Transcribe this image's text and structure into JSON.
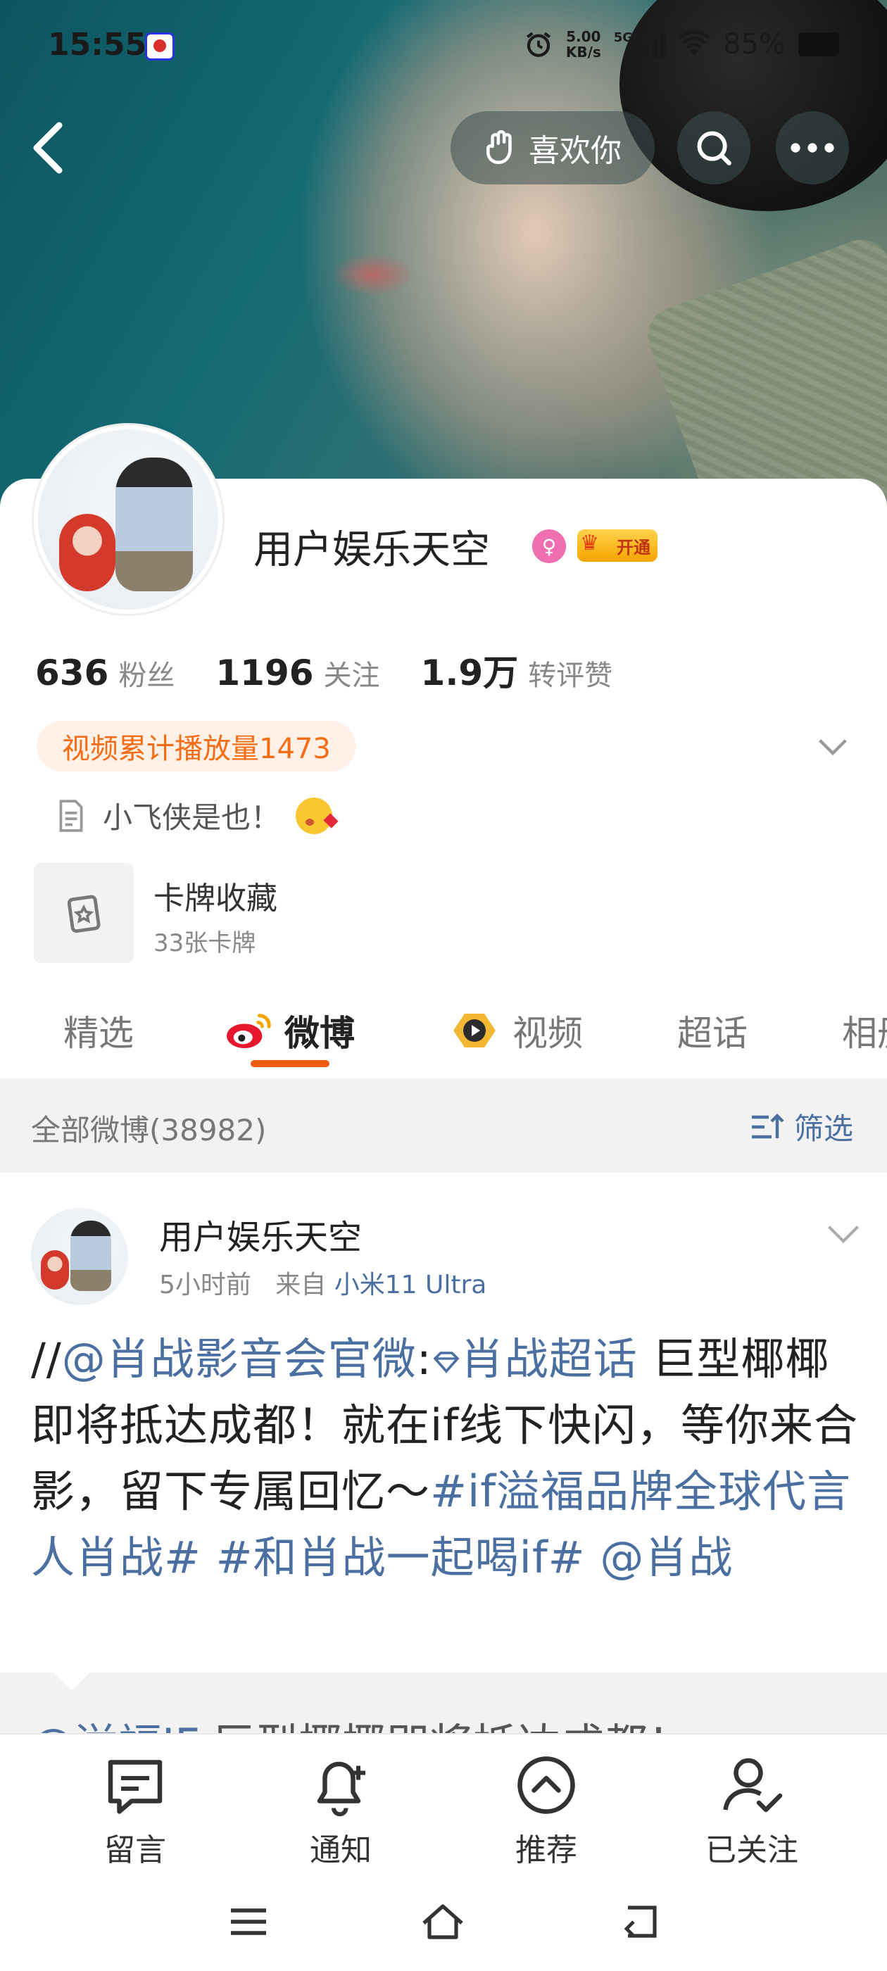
{
  "status_bar": {
    "time": "15:55",
    "speed_value": "5.00",
    "speed_unit": "KB/s",
    "network": "5G",
    "battery": "85%"
  },
  "header": {
    "like_label": "喜欢你"
  },
  "profile": {
    "username": "用户娱乐天空",
    "vip_label": "开通",
    "stats": [
      {
        "value": "636",
        "label": "粉丝"
      },
      {
        "value": "1196",
        "label": "关注"
      },
      {
        "value": "1.9万",
        "label": "转评赞"
      }
    ],
    "play_count": "视频累计播放量1473",
    "bio": "小飞侠是也！",
    "cards_title": "卡牌收藏",
    "cards_count": "33张卡牌"
  },
  "tabs": [
    {
      "label": "精选",
      "active": false
    },
    {
      "label": "微博",
      "active": true
    },
    {
      "label": "视频",
      "active": false
    },
    {
      "label": "超话",
      "active": false
    },
    {
      "label": "相册",
      "active": false
    }
  ],
  "filter": {
    "count_label": "全部微博(38982)",
    "filter_label": "筛选"
  },
  "post": {
    "author": "用户娱乐天空",
    "time": "5小时前",
    "from_label": "来自",
    "device": "小米11 Ultra",
    "body": {
      "prefix": "//",
      "mention": "@肖战影音会官微",
      "colon": ":",
      "topic_link": "肖战超话",
      "text": " 巨型椰椰即将抵达成都！就在if线下快闪，等你来合影，留下专属回忆～",
      "hashtag1": "#if溢福品牌全球代言人肖战#",
      "hashtag2": "#和肖战一起喝if#",
      "mention2": "@肖战"
    },
    "quote_mention": "@溢福IF",
    "quote_text": ":巨型椰椰即将抵达成都！"
  },
  "bottom_bar": [
    {
      "label": "留言",
      "icon": "message-icon"
    },
    {
      "label": "通知",
      "icon": "bell-plus-icon"
    },
    {
      "label": "推荐",
      "icon": "chevron-up-circle-icon"
    },
    {
      "label": "已关注",
      "icon": "user-check-icon"
    }
  ],
  "colors": {
    "accent_orange": "#f25c12",
    "link_blue": "#4a6fa0",
    "play_pill_text": "#f46d14"
  }
}
